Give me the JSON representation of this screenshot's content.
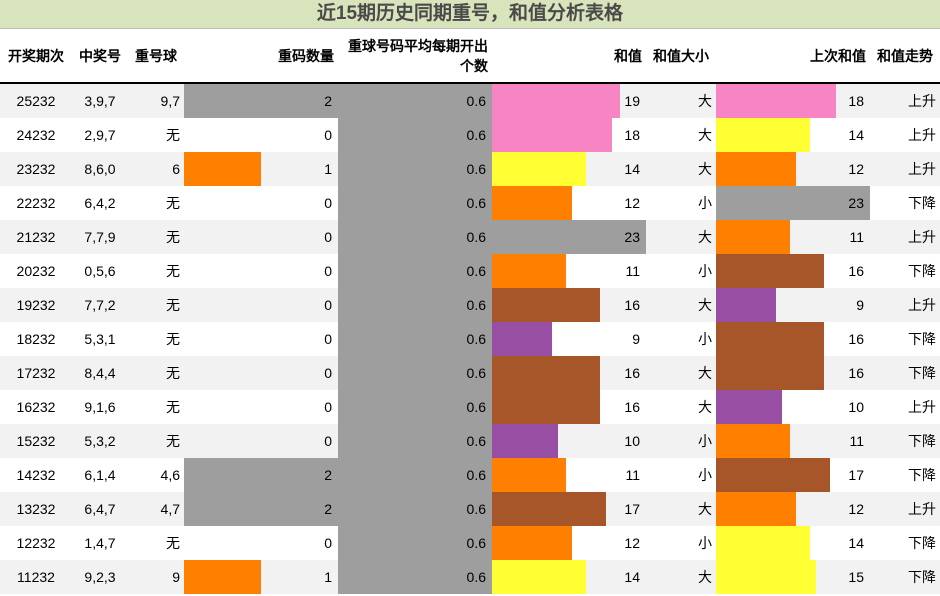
{
  "title": "近15期历史同期重号，和值分析表格",
  "headers": {
    "period": "开奖期次",
    "numbers": "中奖号",
    "repeat_ball": "重号球",
    "repeat_count": "重码数量",
    "avg": "重球号码平均每期开出个数",
    "sum": "和值",
    "size": "和值大小",
    "prev_sum": "上次和值",
    "trend": "和值走势"
  },
  "colors": {
    "gray": "#9e9e9e",
    "orange": "#ff8000",
    "pink": "#f785c4",
    "yellow": "#ffff33",
    "brown": "#a65628",
    "purple": "#984ea3"
  },
  "rows": [
    {
      "period": "25232",
      "numbers": "3,9,7",
      "repeat_ball": "9,7",
      "repeat_count": "2",
      "avg": "0.6",
      "sum": "19",
      "size": "大",
      "prev_sum": "18",
      "trend": "上升"
    },
    {
      "period": "24232",
      "numbers": "2,9,7",
      "repeat_ball": "无",
      "repeat_count": "0",
      "avg": "0.6",
      "sum": "18",
      "size": "大",
      "prev_sum": "14",
      "trend": "上升"
    },
    {
      "period": "23232",
      "numbers": "8,6,0",
      "repeat_ball": "6",
      "repeat_count": "1",
      "avg": "0.6",
      "sum": "14",
      "size": "大",
      "prev_sum": "12",
      "trend": "上升"
    },
    {
      "period": "22232",
      "numbers": "6,4,2",
      "repeat_ball": "无",
      "repeat_count": "0",
      "avg": "0.6",
      "sum": "12",
      "size": "小",
      "prev_sum": "23",
      "trend": "下降"
    },
    {
      "period": "21232",
      "numbers": "7,7,9",
      "repeat_ball": "无",
      "repeat_count": "0",
      "avg": "0.6",
      "sum": "23",
      "size": "大",
      "prev_sum": "11",
      "trend": "上升"
    },
    {
      "period": "20232",
      "numbers": "0,5,6",
      "repeat_ball": "无",
      "repeat_count": "0",
      "avg": "0.6",
      "sum": "11",
      "size": "小",
      "prev_sum": "16",
      "trend": "下降"
    },
    {
      "period": "19232",
      "numbers": "7,7,2",
      "repeat_ball": "无",
      "repeat_count": "0",
      "avg": "0.6",
      "sum": "16",
      "size": "大",
      "prev_sum": "9",
      "trend": "上升"
    },
    {
      "period": "18232",
      "numbers": "5,3,1",
      "repeat_ball": "无",
      "repeat_count": "0",
      "avg": "0.6",
      "sum": "9",
      "size": "小",
      "prev_sum": "16",
      "trend": "下降"
    },
    {
      "period": "17232",
      "numbers": "8,4,4",
      "repeat_ball": "无",
      "repeat_count": "0",
      "avg": "0.6",
      "sum": "16",
      "size": "大",
      "prev_sum": "16",
      "trend": "下降"
    },
    {
      "period": "16232",
      "numbers": "9,1,6",
      "repeat_ball": "无",
      "repeat_count": "0",
      "avg": "0.6",
      "sum": "16",
      "size": "大",
      "prev_sum": "10",
      "trend": "上升"
    },
    {
      "period": "15232",
      "numbers": "5,3,2",
      "repeat_ball": "无",
      "repeat_count": "0",
      "avg": "0.6",
      "sum": "10",
      "size": "小",
      "prev_sum": "11",
      "trend": "下降"
    },
    {
      "period": "14232",
      "numbers": "6,1,4",
      "repeat_ball": "4,6",
      "repeat_count": "2",
      "avg": "0.6",
      "sum": "11",
      "size": "小",
      "prev_sum": "17",
      "trend": "下降"
    },
    {
      "period": "13232",
      "numbers": "6,4,7",
      "repeat_ball": "4,7",
      "repeat_count": "2",
      "avg": "0.6",
      "sum": "17",
      "size": "大",
      "prev_sum": "12",
      "trend": "上升"
    },
    {
      "period": "12232",
      "numbers": "1,4,7",
      "repeat_ball": "无",
      "repeat_count": "0",
      "avg": "0.6",
      "sum": "12",
      "size": "小",
      "prev_sum": "14",
      "trend": "下降"
    },
    {
      "period": "11232",
      "numbers": "9,2,3",
      "repeat_ball": "9",
      "repeat_count": "1",
      "avg": "0.6",
      "sum": "14",
      "size": "大",
      "prev_sum": "15",
      "trend": "下降"
    }
  ]
}
